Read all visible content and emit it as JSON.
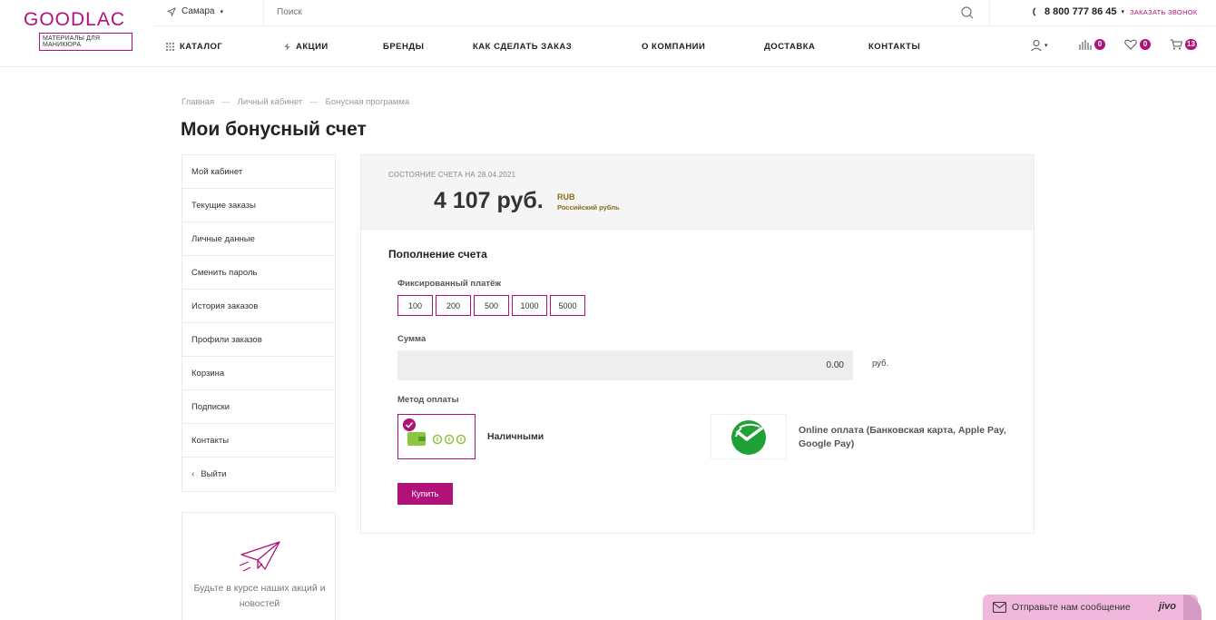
{
  "header": {
    "logo_main": "GOODLAC",
    "logo_sub": "МАТЕРИАЛЫ ДЛЯ МАНИКЮРА",
    "city": "Самара",
    "search_placeholder": "Поиск",
    "phone": "8 800 777 86 45",
    "callback": "ЗАКАЗАТЬ ЗВОНОК",
    "nav": {
      "catalog": "КАТАЛОГ",
      "promo": "АКЦИИ",
      "brands": "БРЕНДЫ",
      "how_to_order": "КАК СДЕЛАТЬ ЗАКАЗ",
      "about": "О КОМПАНИИ",
      "delivery": "ДОСТАВКА",
      "contacts": "КОНТАКТЫ"
    },
    "compare_count": "0",
    "favorites_count": "0",
    "cart_count": "13"
  },
  "breadcrumb": [
    "Главная",
    "Личный кабинет",
    "Бонусная программа"
  ],
  "page_title": "Мои бонусный счет",
  "sidebar": {
    "items": [
      "Мой кабинет",
      "Текущие заказы",
      "Личные данные",
      "Сменить пароль",
      "История заказов",
      "Профили заказов",
      "Корзина",
      "Подписки",
      "Контакты",
      "Выйти"
    ],
    "promo_text": "Будьте в курсе наших акций и новостей"
  },
  "balance": {
    "caption": "СОСТОЯНИЕ СЧЕТА НА 28.04.2021",
    "amount": "4 107 руб.",
    "currency_code": "RUB",
    "currency_name": "Российский рубль"
  },
  "topup": {
    "title": "Пополнение счета",
    "fixed_label": "Фиксированный платёж",
    "fixed_amounts": [
      "100",
      "200",
      "500",
      "1000",
      "5000"
    ],
    "sum_label": "Сумма",
    "sum_value": "0.00",
    "sum_unit": "руб.",
    "method_label": "Метод оплаты",
    "method_cash": "Наличными",
    "method_online": "Online оплата (Банковская карта, Apple Pay, Google Pay)",
    "buy_label": "Купить"
  },
  "chat": {
    "text": "Отправьте нам сообщение",
    "brand": "jivo"
  },
  "colors": {
    "accent": "#b0127a",
    "currency": "#8a6d1a",
    "chat_bg": "#f0b8dc"
  }
}
